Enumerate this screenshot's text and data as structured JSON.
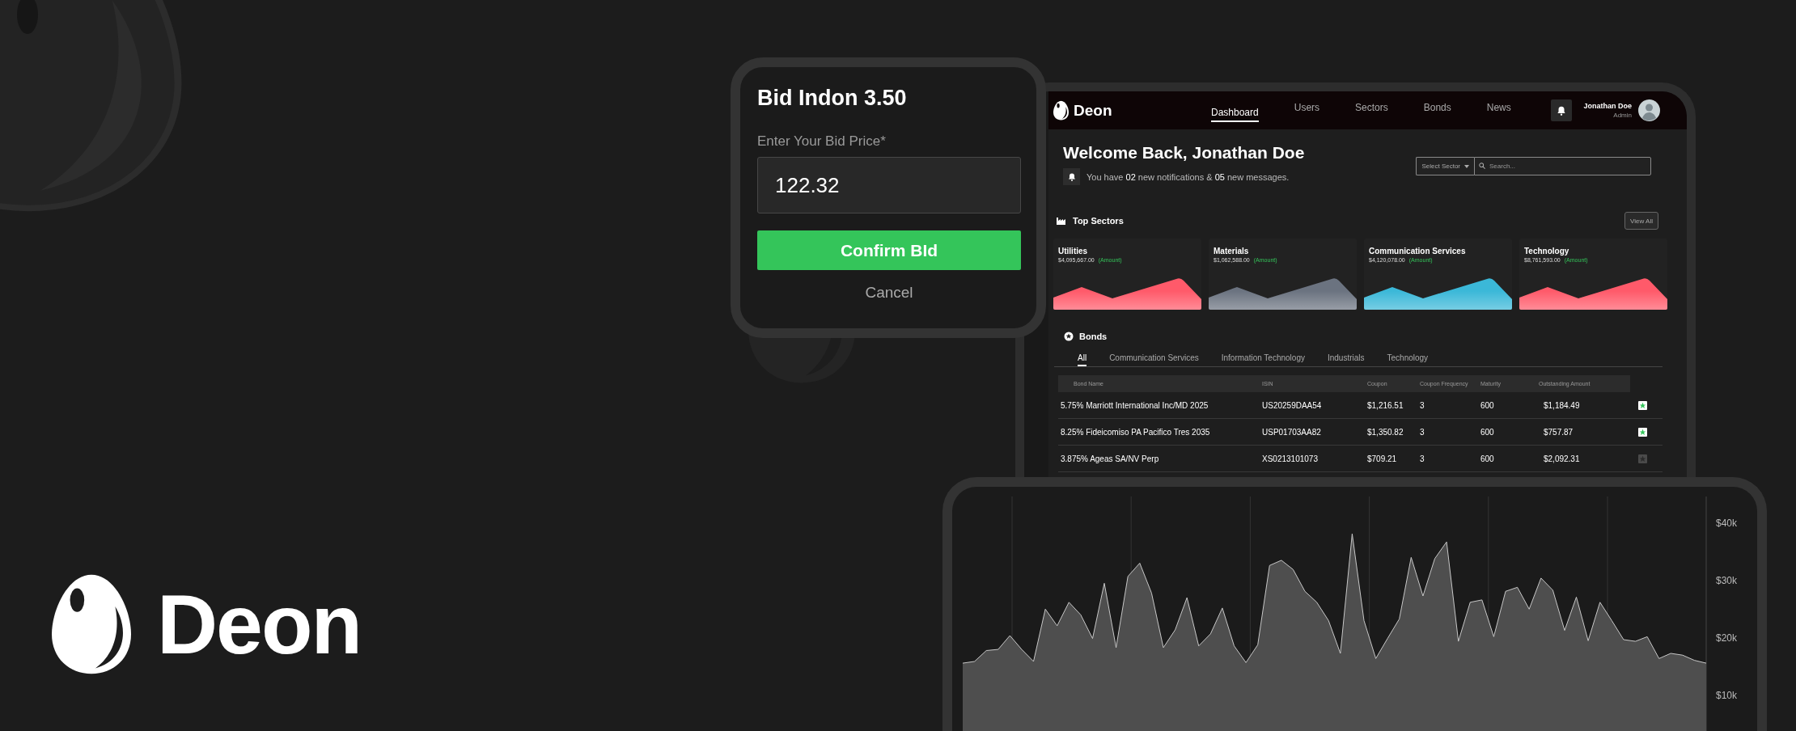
{
  "brand": {
    "name": "Deon"
  },
  "bid_dialog": {
    "title": "Bid Indon 3.50",
    "label": "Enter Your Bid Price*",
    "value": "122.32",
    "confirm": "Confirm BId",
    "cancel": "Cancel"
  },
  "dashboard": {
    "brand": "Deon",
    "nav": [
      {
        "label": "Dashboard",
        "selected": true
      },
      {
        "label": "Users",
        "selected": false
      },
      {
        "label": "Sectors",
        "selected": false
      },
      {
        "label": "Bonds",
        "selected": false
      },
      {
        "label": "News",
        "selected": false
      }
    ],
    "user": {
      "name": "Jonathan Doe",
      "role": "Admin"
    },
    "welcome": {
      "title": "Welcome Back, Jonathan Doe",
      "message": "You have **02** new notifications & **05** new messages."
    },
    "filter": {
      "select": "Select Sector",
      "placeholder": "Search..."
    },
    "top_sectors": {
      "title": "Top Sectors",
      "action": "View All",
      "cards": [
        {
          "name": "Utilities",
          "amount": "$4,095,667.00",
          "note": "(Amount)",
          "color": "#ff5a6a"
        },
        {
          "name": "Materials",
          "amount": "$1,062,588.00",
          "note": "(Amount)",
          "color": "#6b7380"
        },
        {
          "name": "Communication Services",
          "amount": "$4,120,078.00",
          "note": "(Amount)",
          "color": "#3bb8d8"
        },
        {
          "name": "Technology",
          "amount": "$8,761,593.00",
          "note": "(Amount)",
          "color": "#ff5a6a"
        }
      ]
    },
    "bonds": {
      "title": "Bonds",
      "tabs": [
        {
          "label": "All",
          "selected": true
        },
        {
          "label": "Communication Services",
          "selected": false
        },
        {
          "label": "Information Technology",
          "selected": false
        },
        {
          "label": "Industrials",
          "selected": false
        },
        {
          "label": "Technology",
          "selected": false
        }
      ],
      "columns": [
        "Bond Name",
        "ISIN",
        "Coupon",
        "Coupon Frequency",
        "Maturity",
        "Outstanding Amount"
      ],
      "rows": [
        {
          "cells": [
            "5.75% Marriott International Inc/MD 2025",
            "US20259DAA54",
            "$1,216.51",
            "3",
            "600",
            "$1,184.49"
          ],
          "favorite": true
        },
        {
          "cells": [
            "8.25% Fideicomiso PA Pacifico Tres 2035",
            "USP01703AA82",
            "$1,350.82",
            "3",
            "600",
            "$757.87"
          ],
          "favorite": true
        },
        {
          "cells": [
            "3.875% Ageas SA/NV Perp",
            "XS0213101073",
            "$709.21",
            "3",
            "600",
            "$2,092.31"
          ],
          "favorite": false
        }
      ]
    }
  },
  "chart": {
    "chart_data": {
      "type": "area",
      "ylim": [
        0,
        44.6
      ],
      "categories": [
        null,
        null,
        null,
        null,
        null,
        null,
        null,
        null,
        null,
        null,
        null,
        null,
        null,
        null,
        null,
        null,
        null,
        null,
        null,
        null,
        null,
        null,
        null,
        null,
        null,
        null,
        null,
        null,
        null,
        null,
        null,
        null,
        null,
        null,
        null,
        null,
        null,
        null,
        null,
        null,
        null,
        null,
        null,
        null,
        null,
        null,
        null,
        null,
        null,
        null,
        null,
        null,
        null,
        null,
        null,
        null,
        null,
        null,
        null,
        null,
        null,
        null,
        null,
        null
      ],
      "yticks": [
        {
          "value": 40,
          "label": "$40k"
        },
        {
          "value": 30,
          "label": "$30k"
        },
        {
          "value": 20,
          "label": "$20k"
        },
        {
          "value": 10,
          "label": "$10k"
        }
      ],
      "series": [
        {
          "color": "#c8c8c8",
          "values": [
            15.6,
            15.9,
            17.8,
            18,
            20.4,
            18,
            15.9,
            25,
            22.1,
            26.2,
            24,
            19.9,
            29.5,
            18.3,
            30.7,
            33,
            27.8,
            18.3,
            21.4,
            27,
            18.6,
            20.7,
            25.2,
            18.6,
            15.7,
            18.8,
            32.6,
            33.5,
            31.9,
            28.1,
            26.2,
            23,
            17.3,
            38.1,
            23,
            16.4,
            19.9,
            23.3,
            34,
            27.3,
            33.8,
            36.7,
            19.4,
            26.2,
            26.6,
            20.2,
            28.1,
            28.8,
            25,
            30.4,
            28.3,
            21.3,
            27.1,
            19.5,
            26.2,
            23,
            19.7,
            19.4,
            20.2,
            16.4,
            17.3,
            17,
            16.1,
            15.6
          ]
        }
      ]
    }
  }
}
